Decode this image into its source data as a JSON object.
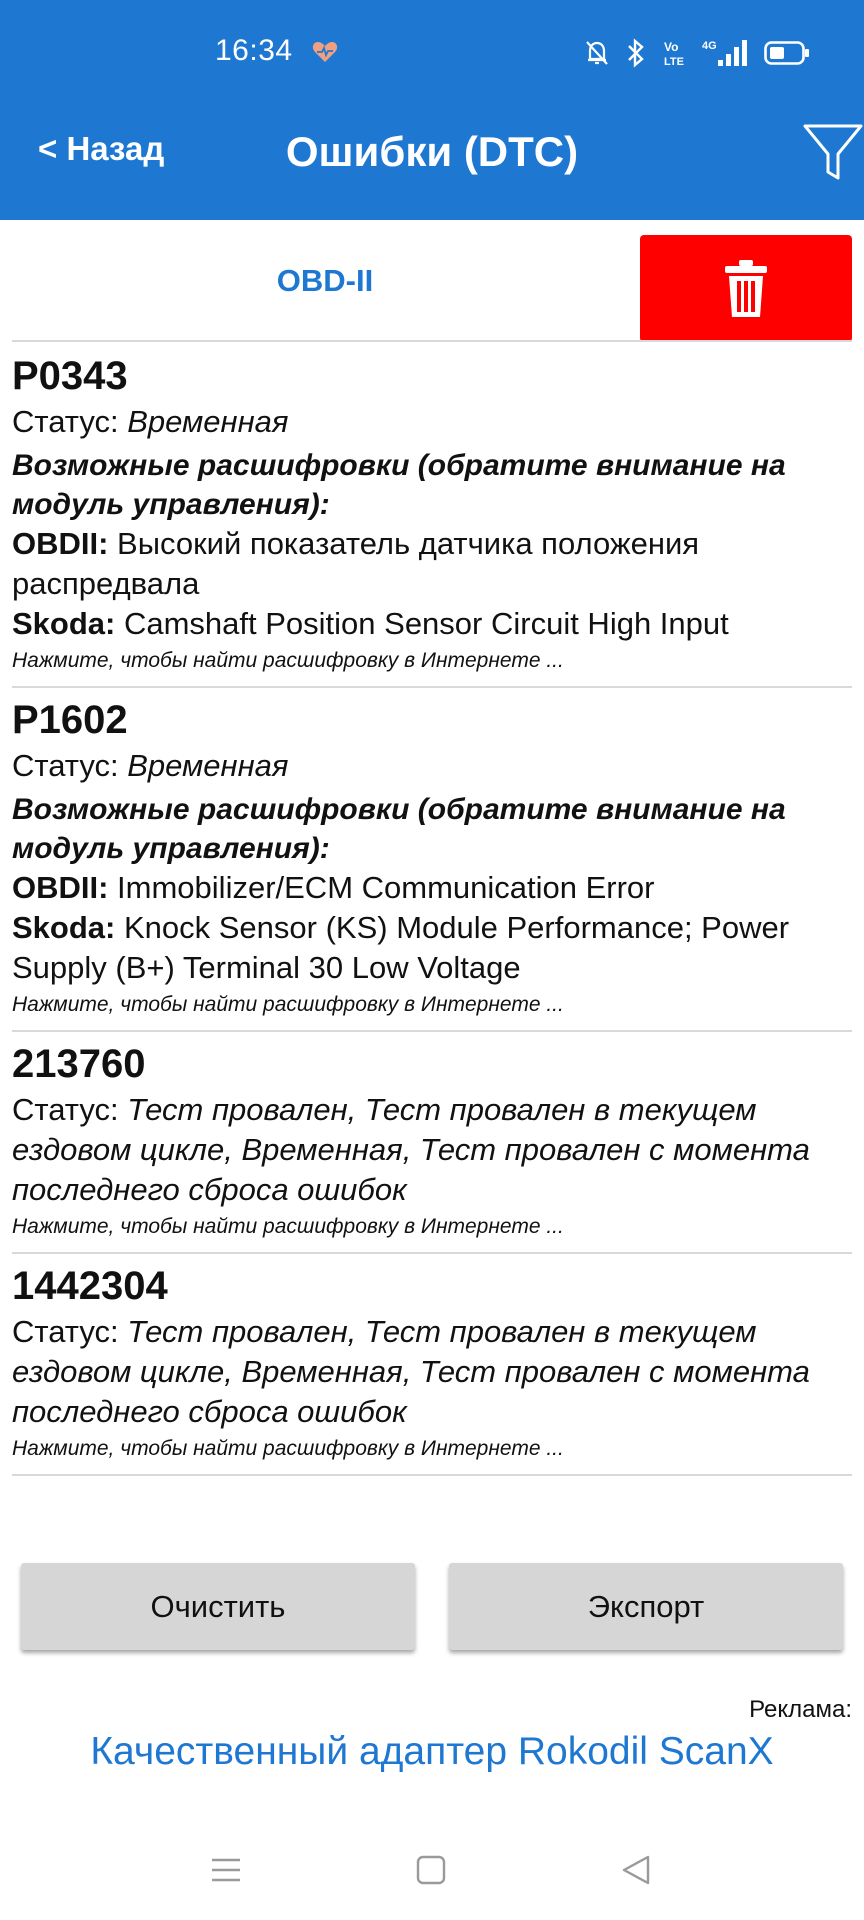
{
  "status_bar": {
    "time": "16:34",
    "icons": [
      "heart-icon",
      "mute-bell-icon",
      "bluetooth-icon",
      "volte-icon",
      "4g-signal-icon",
      "battery-icon"
    ],
    "volte_text": "Vo LTE",
    "network_text": "4G"
  },
  "header": {
    "back_label": "< Назад",
    "title": "Ошибки (DTC)",
    "filter_icon": "filter-icon",
    "background": "#1e78d2"
  },
  "tabs": {
    "obd_label": "OBD-II",
    "delete_icon": "trash-icon",
    "delete_color": "#ff0000"
  },
  "dtc_list": [
    {
      "code": "P0343",
      "status_prefix": "Статус: ",
      "status": "Временная",
      "decode_header": "Возможные расшифровки (обратите внимание на модуль управления):",
      "obd_label": "OBDII:",
      "obd_text": " Высокий показатель датчика положения распредвала",
      "make_label": "Skoda:",
      "make_text": " Camshaft Position Sensor Circuit High Input",
      "hint": "Нажмите, чтобы найти расшифровку в Интернете ..."
    },
    {
      "code": "P1602",
      "status_prefix": "Статус: ",
      "status": "Временная",
      "decode_header": "Возможные расшифровки (обратите внимание на модуль управления):",
      "obd_label": "OBDII:",
      "obd_text": " Immobilizer/ECM Communication Error",
      "make_label": "Skoda:",
      "make_text": " Knock Sensor (KS) Module Performance; Power Supply (B+) Terminal 30 Low Voltage",
      "hint": "Нажмите, чтобы найти расшифровку в Интернете ..."
    },
    {
      "code": "213760",
      "status_prefix": "Статус: ",
      "status": "Тест провален, Тест провален в текущем ездовом цикле, Временная, Тест провален с момента последнего сброса ошибок",
      "hint": "Нажмите, чтобы найти расшифровку в Интернете ..."
    },
    {
      "code": "1442304",
      "status_prefix": "Статус: ",
      "status": "Тест провален, Тест провален в текущем ездовом цикле, Временная, Тест провален с момента последнего сброса ошибок",
      "hint": "Нажмите, чтобы найти расшифровку в Интернете ..."
    }
  ],
  "actions": {
    "clear_label": "Очистить",
    "export_label": "Экспорт"
  },
  "ad": {
    "label": "Реклама:",
    "link_text": "Качественный адаптер Rokodil ScanX",
    "link_color": "#1e78d2"
  },
  "nav_bar": {
    "icons": [
      "menu-icon",
      "home-square-icon",
      "back-triangle-icon"
    ]
  }
}
